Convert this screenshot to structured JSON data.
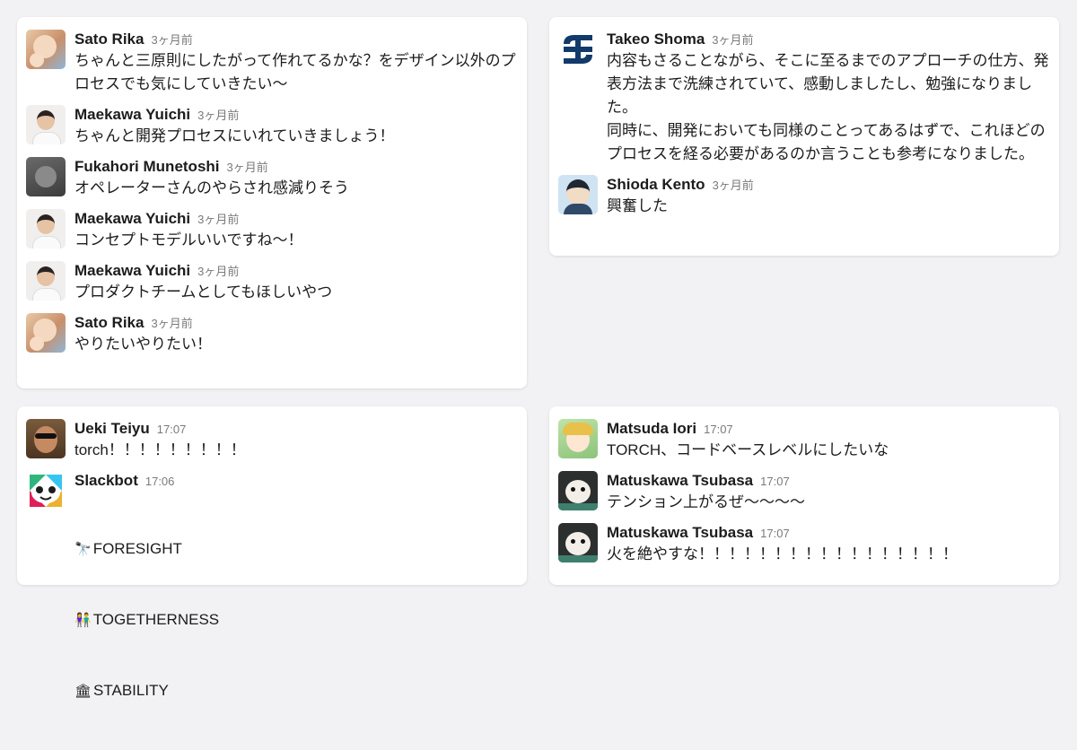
{
  "cards": [
    {
      "messages": [
        {
          "user": "Sato Rika",
          "time": "3ヶ月前",
          "text": "ちゃんと三原則にしたがって作れてるかな？をデザイン以外のプロセスでも気にしていきたい〜"
        },
        {
          "user": "Maekawa Yuichi",
          "time": "3ヶ月前",
          "text": "ちゃんと開発プロセスにいれていきましょう！"
        },
        {
          "user": "Fukahori Munetoshi",
          "time": "3ヶ月前",
          "text": "オペレーターさんのやらされ感減りそう"
        },
        {
          "user": "Maekawa Yuichi",
          "time": "3ヶ月前",
          "text": "コンセプトモデルいいですね〜！"
        },
        {
          "user": "Maekawa Yuichi",
          "time": "3ヶ月前",
          "text": "プロダクトチームとしてもほしいやつ"
        },
        {
          "user": "Sato Rika",
          "time": "3ヶ月前",
          "text": "やりたいやりたい！"
        }
      ]
    },
    {
      "messages": [
        {
          "user": "Takeo Shoma",
          "time": "3ヶ月前",
          "text": "内容もさることながら、そこに至るまでのアプローチの仕方、発表方法まで洗練されていて、感動しましたし、勉強になりました。\n同時に、開発においても同様のことってあるはずで、これほどのプロセスを経る必要があるのか言うことも参考になりました。"
        },
        {
          "user": "Shioda Kento",
          "time": "3ヶ月前",
          "text": "興奮した"
        }
      ]
    },
    {
      "messages": [
        {
          "user": "Ueki Teiyu",
          "time": "17:07",
          "text": "torch！！！！！！！！！"
        },
        {
          "user": "Slackbot",
          "time": "17:06",
          "lines": [
            {
              "emoji": "🔭",
              "text": "FORESIGHT"
            },
            {
              "emoji": "👫",
              "text": "TOGETHERNESS"
            },
            {
              "emoji": "🏛",
              "text": "STABILITY"
            }
          ]
        }
      ]
    },
    {
      "messages": [
        {
          "user": "Matsuda Iori",
          "time": "17:07",
          "text": "TORCH、コードベースレベルにしたいな"
        },
        {
          "user": "Matuskawa Tsubasa",
          "time": "17:07",
          "text": "テンション上がるぜ〜〜〜〜"
        },
        {
          "user": "Matuskawa Tsubasa",
          "time": "17:07",
          "text": "火を絶やすな！！！！！！！！！！！！！！！！！"
        }
      ]
    }
  ]
}
